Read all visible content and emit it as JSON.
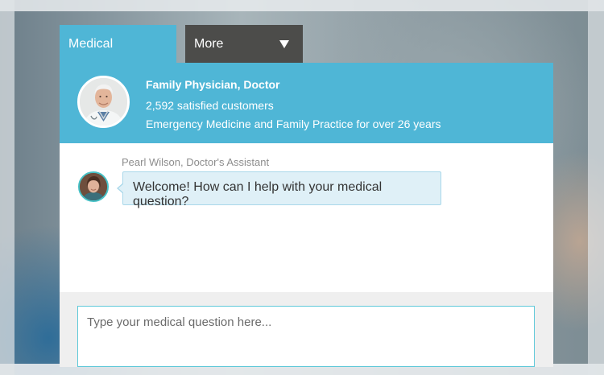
{
  "tabs": {
    "medical_label": "Medical",
    "more_label": "More"
  },
  "expert": {
    "title": "Family Physician, Doctor",
    "customers": "2,592 satisfied customers",
    "experience": "Emergency Medicine and Family Practice for over 26 years",
    "avatar_icon": "doctor-photo"
  },
  "chat": {
    "assistant_name": "Pearl Wilson, Doctor's Assistant",
    "assistant_avatar_icon": "assistant-photo",
    "message": "Welcome! How can I help with your medical question?"
  },
  "input": {
    "placeholder": "Type your medical question here...",
    "value": ""
  },
  "colors": {
    "accent": "#4fb6d6",
    "tab_dark": "#4c4c4a",
    "bubble": "#dff0f7",
    "input_border": "#5fc9d9"
  }
}
